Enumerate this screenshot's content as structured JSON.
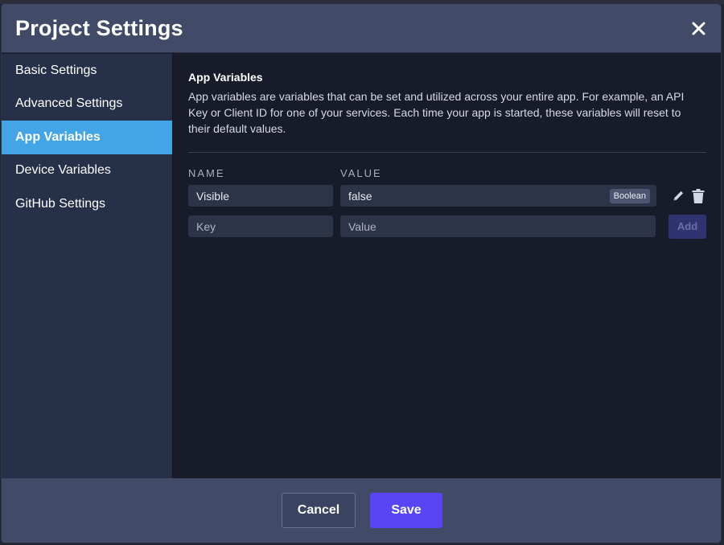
{
  "modal": {
    "title": "Project Settings"
  },
  "sidebar": {
    "items": [
      {
        "label": "Basic Settings"
      },
      {
        "label": "Advanced Settings"
      },
      {
        "label": "App Variables",
        "active": true
      },
      {
        "label": "Device Variables"
      },
      {
        "label": "GitHub Settings"
      }
    ]
  },
  "content": {
    "section_title": "App Variables",
    "section_desc": "App variables are variables that can be set and utilized across your entire app. For example, an API Key or Client ID for one of your services. Each time your app is started, these variables will reset to their default values.",
    "columns": {
      "name": "NAME",
      "value": "VALUE"
    },
    "variables": [
      {
        "name": "Visible",
        "value": "false",
        "type": "Boolean"
      }
    ],
    "new_row": {
      "key_placeholder": "Key",
      "value_placeholder": "Value",
      "add_label": "Add"
    }
  },
  "footer": {
    "cancel_label": "Cancel",
    "save_label": "Save"
  },
  "icons": {
    "close": "close-icon",
    "edit": "pencil-icon",
    "delete": "trash-icon"
  },
  "colors": {
    "header_bg": "#414b68",
    "sidebar_bg": "#273049",
    "active_item": "#43a5e5",
    "content_bg": "#171b2a",
    "save_button": "#5a45f5",
    "add_button": "#2f3470"
  }
}
